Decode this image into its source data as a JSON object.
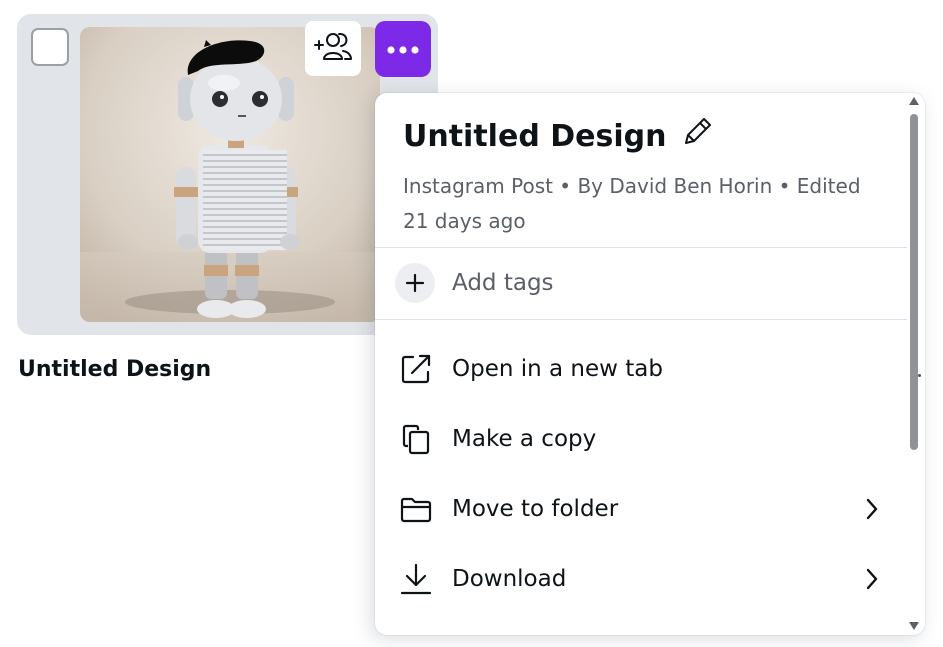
{
  "design_card": {
    "title": "Untitled Design"
  },
  "context_menu": {
    "title": "Untitled Design",
    "meta_line_1": "Instagram Post • By David Ben Horin • Edited",
    "meta_line_2": "21 days ago",
    "add_tags_label": "Add tags",
    "items": [
      {
        "label": "Open in a new tab",
        "icon": "external-link-icon",
        "has_submenu": false
      },
      {
        "label": "Make a copy",
        "icon": "copy-icon",
        "has_submenu": false
      },
      {
        "label": "Move to folder",
        "icon": "folder-icon",
        "has_submenu": true
      },
      {
        "label": "Download",
        "icon": "download-icon",
        "has_submenu": true
      }
    ]
  },
  "icons": {
    "checkbox": "checkbox-icon",
    "share": "add-collaborator-icon",
    "more": "more-options-icon",
    "edit": "pencil-icon",
    "add_tag": "plus-icon",
    "submenu": "chevron-right-icon"
  },
  "colors": {
    "accent_purple": "#7d2ae8",
    "card_bg": "#e1e4e8",
    "text_primary": "#0e1318",
    "text_secondary": "#5b6068"
  }
}
